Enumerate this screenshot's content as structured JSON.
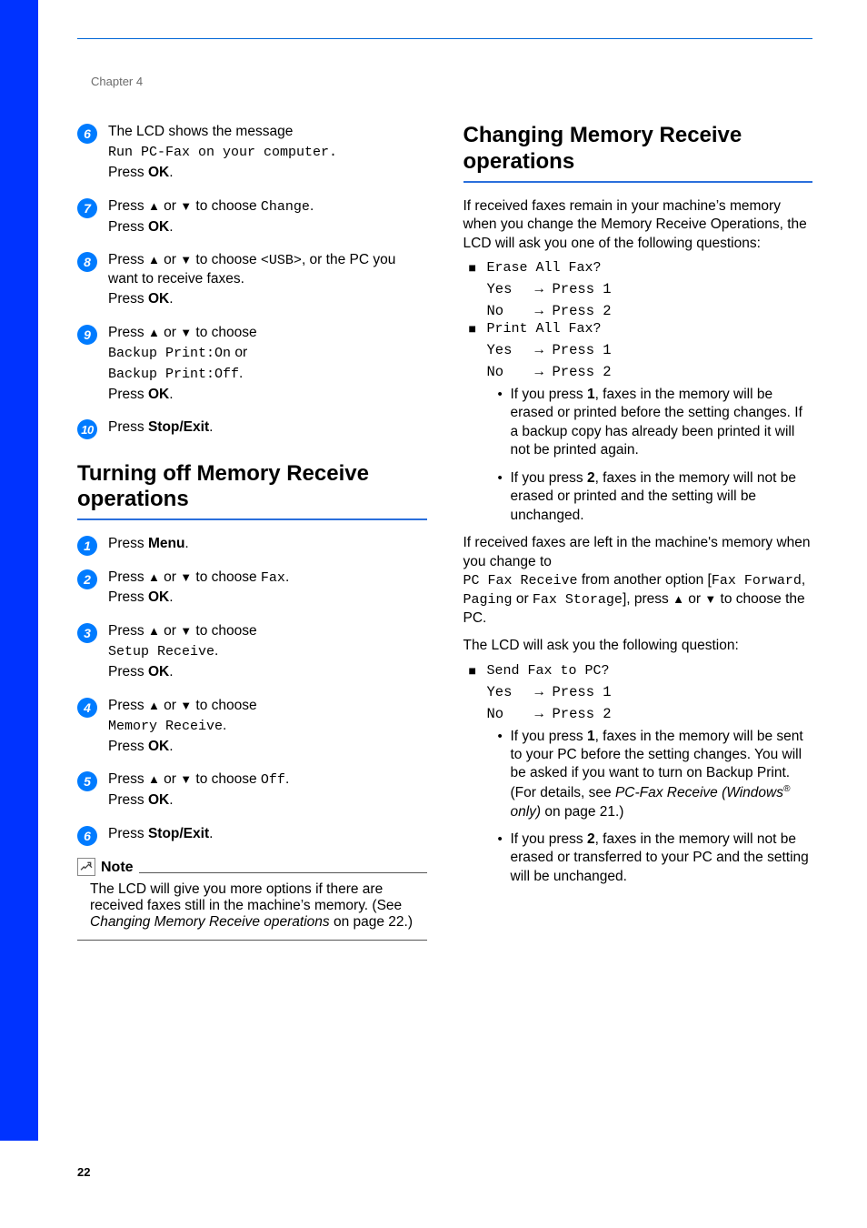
{
  "chapter": "Chapter 4",
  "pageNumber": "22",
  "left": {
    "steps_a": [
      {
        "n": "6",
        "lines": [
          {
            "segs": [
              {
                "t": "The LCD shows the message "
              }
            ]
          },
          {
            "segs": [
              {
                "t": "Run PC-Fax on your computer.",
                "cls": "mono"
              }
            ]
          },
          {
            "segs": [
              {
                "t": "Press "
              },
              {
                "t": "OK",
                "cls": "btn"
              },
              {
                "t": "."
              }
            ]
          }
        ]
      },
      {
        "n": "7",
        "lines": [
          {
            "segs": [
              {
                "t": "Press "
              },
              {
                "t": "a",
                "cls": "updown",
                "which": "up"
              },
              {
                "t": " or "
              },
              {
                "t": "b",
                "cls": "updown",
                "which": "down"
              },
              {
                "t": " to choose "
              },
              {
                "t": "Change",
                "cls": "mono"
              },
              {
                "t": "."
              }
            ]
          },
          {
            "segs": [
              {
                "t": "Press "
              },
              {
                "t": "OK",
                "cls": "btn"
              },
              {
                "t": "."
              }
            ]
          }
        ]
      },
      {
        "n": "8",
        "lines": [
          {
            "segs": [
              {
                "t": "Press "
              },
              {
                "t": "a",
                "cls": "updown",
                "which": "up"
              },
              {
                "t": " or "
              },
              {
                "t": "b",
                "cls": "updown",
                "which": "down"
              },
              {
                "t": " to choose "
              },
              {
                "t": "<USB>",
                "cls": "mono"
              },
              {
                "t": ", or the PC you want to receive faxes."
              }
            ]
          },
          {
            "segs": [
              {
                "t": "Press "
              },
              {
                "t": "OK",
                "cls": "btn"
              },
              {
                "t": "."
              }
            ]
          }
        ]
      },
      {
        "n": "9",
        "lines": [
          {
            "segs": [
              {
                "t": "Press "
              },
              {
                "t": "a",
                "cls": "updown",
                "which": "up"
              },
              {
                "t": " or "
              },
              {
                "t": "b",
                "cls": "updown",
                "which": "down"
              },
              {
                "t": " to choose "
              }
            ]
          },
          {
            "segs": [
              {
                "t": "Backup Print:On",
                "cls": "mono"
              },
              {
                "t": " or"
              }
            ]
          },
          {
            "segs": [
              {
                "t": "Backup Print:Off",
                "cls": "mono"
              },
              {
                "t": "."
              }
            ]
          },
          {
            "segs": [
              {
                "t": "Press "
              },
              {
                "t": "OK",
                "cls": "btn"
              },
              {
                "t": "."
              }
            ]
          }
        ]
      },
      {
        "n": "10",
        "lines": [
          {
            "segs": [
              {
                "t": "Press "
              },
              {
                "t": "Stop/Exit",
                "cls": "btn"
              },
              {
                "t": "."
              }
            ]
          }
        ]
      }
    ],
    "h2a": "Turning off Memory Receive operations",
    "steps_b": [
      {
        "n": "1",
        "lines": [
          {
            "segs": [
              {
                "t": "Press "
              },
              {
                "t": "Menu",
                "cls": "btn"
              },
              {
                "t": "."
              }
            ]
          }
        ]
      },
      {
        "n": "2",
        "lines": [
          {
            "segs": [
              {
                "t": "Press "
              },
              {
                "t": "a",
                "cls": "updown",
                "which": "up"
              },
              {
                "t": " or "
              },
              {
                "t": "b",
                "cls": "updown",
                "which": "down"
              },
              {
                "t": " to choose "
              },
              {
                "t": "Fax",
                "cls": "mono"
              },
              {
                "t": "."
              }
            ]
          },
          {
            "segs": [
              {
                "t": "Press "
              },
              {
                "t": "OK",
                "cls": "btn"
              },
              {
                "t": "."
              }
            ]
          }
        ]
      },
      {
        "n": "3",
        "lines": [
          {
            "segs": [
              {
                "t": "Press "
              },
              {
                "t": "a",
                "cls": "updown",
                "which": "up"
              },
              {
                "t": " or "
              },
              {
                "t": "b",
                "cls": "updown",
                "which": "down"
              },
              {
                "t": " to choose "
              }
            ]
          },
          {
            "segs": [
              {
                "t": "Setup Receive",
                "cls": "mono"
              },
              {
                "t": "."
              }
            ]
          },
          {
            "segs": [
              {
                "t": "Press "
              },
              {
                "t": "OK",
                "cls": "btn"
              },
              {
                "t": "."
              }
            ]
          }
        ]
      },
      {
        "n": "4",
        "lines": [
          {
            "segs": [
              {
                "t": "Press "
              },
              {
                "t": "a",
                "cls": "updown",
                "which": "up"
              },
              {
                "t": " or "
              },
              {
                "t": "b",
                "cls": "updown",
                "which": "down"
              },
              {
                "t": " to choose "
              }
            ]
          },
          {
            "segs": [
              {
                "t": "Memory Receive",
                "cls": "mono"
              },
              {
                "t": "."
              }
            ]
          },
          {
            "segs": [
              {
                "t": "Press "
              },
              {
                "t": "OK",
                "cls": "btn"
              },
              {
                "t": "."
              }
            ]
          }
        ]
      },
      {
        "n": "5",
        "lines": [
          {
            "segs": [
              {
                "t": "Press "
              },
              {
                "t": "a",
                "cls": "updown",
                "which": "up"
              },
              {
                "t": " or "
              },
              {
                "t": "b",
                "cls": "updown",
                "which": "down"
              },
              {
                "t": " to choose "
              },
              {
                "t": "Off",
                "cls": "mono"
              },
              {
                "t": "."
              }
            ]
          },
          {
            "segs": [
              {
                "t": "Press "
              },
              {
                "t": "OK",
                "cls": "btn"
              },
              {
                "t": "."
              }
            ]
          }
        ]
      },
      {
        "n": "6",
        "lines": [
          {
            "segs": [
              {
                "t": "Press "
              },
              {
                "t": "Stop/Exit",
                "cls": "btn"
              },
              {
                "t": "."
              }
            ]
          }
        ]
      }
    ],
    "note": {
      "label": "Note",
      "body_pre": "The LCD will give you more options if there are received faxes still in the machine’s memory. (See ",
      "body_ital": "Changing Memory Receive operations",
      "body_post": " on page 22.)"
    }
  },
  "right": {
    "h2": "Changing Memory Receive operations",
    "intro": "If received faxes remain in your machine’s memory when you change the Memory Receive Operations, the LCD will ask you one of the following questions:",
    "group1": [
      {
        "title": "Erase All Fax?",
        "rows": [
          [
            "Yes",
            "Press 1"
          ],
          [
            "No",
            "Press 2"
          ]
        ]
      },
      {
        "title": "Print All Fax?",
        "rows": [
          [
            "Yes",
            "Press 1"
          ],
          [
            "No",
            "Press 2"
          ]
        ]
      }
    ],
    "bullets1": [
      {
        "segs": [
          {
            "t": "If you press "
          },
          {
            "t": "1",
            "cls": "bold1"
          },
          {
            "t": ", faxes in the memory will be erased or printed before the setting changes. If a backup copy has already been printed it will not be printed again."
          }
        ]
      },
      {
        "segs": [
          {
            "t": "If you press "
          },
          {
            "t": "2",
            "cls": "bold1"
          },
          {
            "t": ", faxes in the memory will not be erased or printed and the setting will be unchanged."
          }
        ]
      }
    ],
    "mid_para": {
      "segs": [
        {
          "t": "If received faxes are left in the machine's memory when you change to "
        },
        {
          "br": true
        },
        {
          "t": "PC Fax Receive",
          "cls": "mono"
        },
        {
          "t": " from another option ["
        },
        {
          "t": "Fax Forward",
          "cls": "mono"
        },
        {
          "t": ", "
        },
        {
          "t": "Paging",
          "cls": "mono"
        },
        {
          "t": " or "
        },
        {
          "t": "Fax Storage",
          "cls": "mono"
        },
        {
          "t": "], press "
        },
        {
          "t": "a",
          "cls": "updown",
          "which": "up"
        },
        {
          "t": " or "
        },
        {
          "t": "b",
          "cls": "updown",
          "which": "down"
        },
        {
          "t": " to choose the PC."
        }
      ]
    },
    "mid2": "The LCD will ask you the following question:",
    "group2": [
      {
        "title": "Send Fax to PC?",
        "rows": [
          [
            "Yes",
            "Press 1"
          ],
          [
            "No",
            "Press 2"
          ]
        ]
      }
    ],
    "bullets2": [
      {
        "segs": [
          {
            "t": "If you press "
          },
          {
            "t": "1",
            "cls": "bold1"
          },
          {
            "t": ", faxes in the memory will be sent to your PC before the setting changes. You will be asked if you want to turn on Backup Print. (For details, see "
          },
          {
            "t": "PC-Fax Receive (Windows",
            "cls": "italic"
          },
          {
            "t": "®",
            "cls": "sup italic"
          },
          {
            "t": " only)",
            "cls": "italic"
          },
          {
            "t": " on page 21.)"
          }
        ]
      },
      {
        "segs": [
          {
            "t": "If you press "
          },
          {
            "t": "2",
            "cls": "bold1"
          },
          {
            "t": ", faxes in the memory will not be erased or transferred to your PC and the setting will be unchanged."
          }
        ]
      }
    ]
  }
}
